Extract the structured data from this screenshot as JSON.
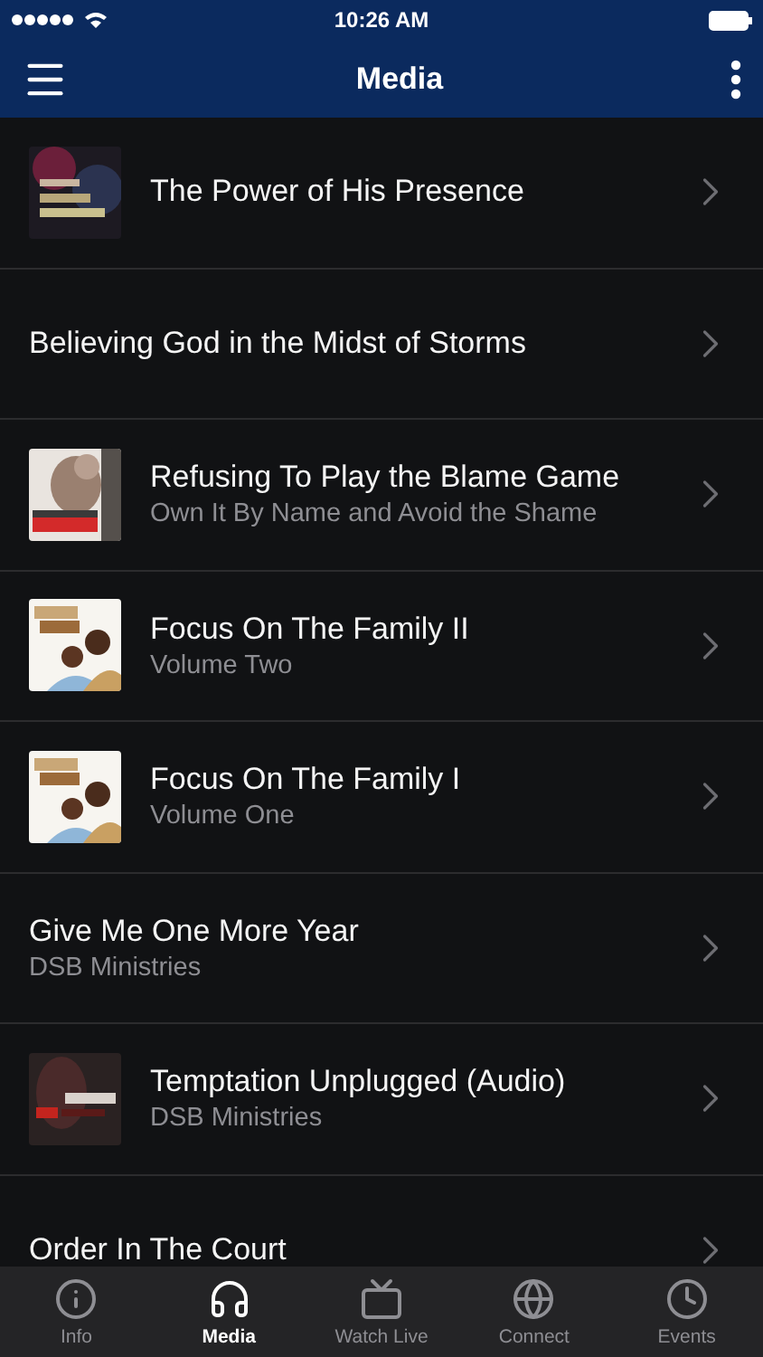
{
  "status_bar": {
    "time": "10:26 AM"
  },
  "nav_bar": {
    "title": "Media"
  },
  "media_items": [
    {
      "kind": "picture",
      "title": "The Power of His Presence"
    },
    {
      "kind": "text",
      "title": "Believing God in the Midst of Storms"
    },
    {
      "kind": "picture",
      "title": "Refusing To Play the Blame Game",
      "subtitle": "Own It By Name and Avoid the Shame"
    },
    {
      "kind": "picture",
      "title": "Focus On The Family II",
      "subtitle": "Volume Two"
    },
    {
      "kind": "picture",
      "title": "Focus On The Family I",
      "subtitle": "Volume One"
    },
    {
      "kind": "text",
      "title": "Give Me One More Year",
      "subtitle": "DSB Ministries"
    },
    {
      "kind": "picture",
      "title": "Temptation Unplugged (Audio)",
      "subtitle": "DSB Ministries"
    },
    {
      "kind": "text",
      "title": "Order In The Court"
    }
  ],
  "tab_bar": [
    {
      "label": "Info",
      "selected": false
    },
    {
      "label": "Media",
      "selected": true
    },
    {
      "label": "Watch Live",
      "selected": false
    },
    {
      "label": "Connect",
      "selected": false
    },
    {
      "label": "Events",
      "selected": false
    }
  ]
}
